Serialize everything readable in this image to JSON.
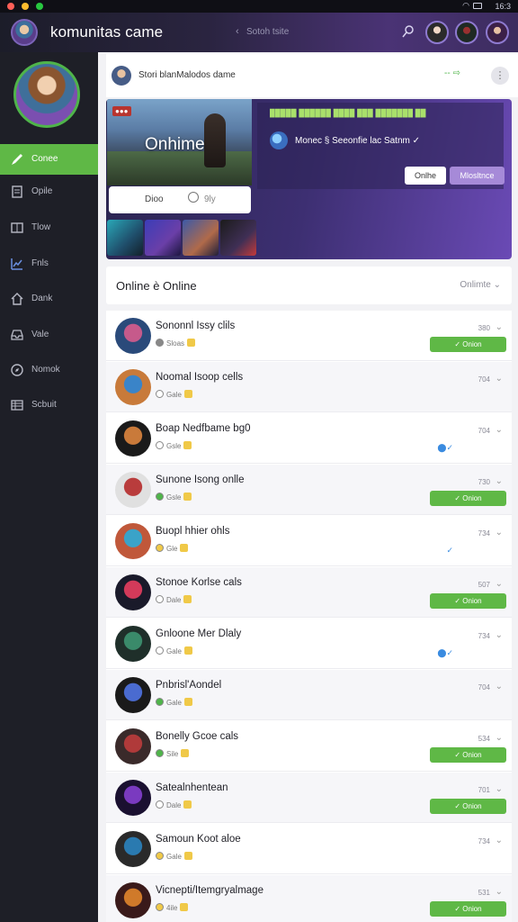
{
  "system": {
    "status": "16:3"
  },
  "header": {
    "title": "komunitas came",
    "search_text": "Sotoh tsite"
  },
  "breadcrumb": {
    "text": "Stori blanMalodos dame",
    "action": "-- ⇨"
  },
  "sidebar": {
    "items": [
      {
        "label": "Conee",
        "icon": "pen-icon"
      },
      {
        "label": "Opile",
        "icon": "document-icon"
      },
      {
        "label": "Tlow",
        "icon": "book-icon"
      },
      {
        "label": "Fnls",
        "icon": "chart-icon"
      },
      {
        "label": "Dank",
        "icon": "home-icon"
      },
      {
        "label": "Vale",
        "icon": "inbox-icon"
      },
      {
        "label": "Nomok",
        "icon": "compass-icon"
      },
      {
        "label": "Scbuit",
        "icon": "grid-icon"
      }
    ]
  },
  "banner": {
    "badge": "●●●",
    "feature_title": "Onhime",
    "feature_card": {
      "count": "Dioo",
      "tag": "9ly"
    },
    "promo_header": "█████ ██████ ████ ███ ███████ ██",
    "promo_text": "Monec § Seeonfie lac Satnm ✓",
    "btn_secondary": "Onlhe",
    "btn_primary": "Mlosltnce"
  },
  "section": {
    "title": "Online è Online",
    "filter": "Onlimte"
  },
  "list": [
    {
      "name": "Sononnl Issy clils",
      "sub": "Sloas",
      "num": "380",
      "btn": "✓ Onion",
      "status": "#888",
      "badge": ""
    },
    {
      "name": "Noomal Isoop cells",
      "sub": "Gale",
      "num": "704",
      "btn": "",
      "status": "#fff",
      "badge": ""
    },
    {
      "name": "Boap Nedfbame bg0",
      "sub": "Gsle",
      "num": "704",
      "btn": "",
      "status": "#fff",
      "badge": "⬤✓"
    },
    {
      "name": "Sunone Isong onlle",
      "sub": "Gsle",
      "num": "730",
      "btn": "✓ Onion",
      "status": "#4fb44a",
      "badge": ""
    },
    {
      "name": "Buopl hhier ohls",
      "sub": "Gle",
      "num": "734",
      "btn": "",
      "status": "#f0c948",
      "badge": "✓"
    },
    {
      "name": "Stonoe Korlse cals",
      "sub": "Dale",
      "num": "507",
      "btn": "✓ Onion",
      "status": "#fff",
      "badge": ""
    },
    {
      "name": "Gnloone Mer Dlaly",
      "sub": "Gale",
      "num": "734",
      "btn": "",
      "status": "#fff",
      "badge": "⬤✓"
    },
    {
      "name": "Pnbrisl'Aondel",
      "sub": "Gale",
      "num": "704",
      "btn": "",
      "status": "#4fb44a",
      "badge": ""
    },
    {
      "name": "Bonelly Gcoe cals",
      "sub": "Sile",
      "num": "534",
      "btn": "✓ Onion",
      "status": "#4fb44a",
      "badge": ""
    },
    {
      "name": "Satealnhentean",
      "sub": "Dale",
      "num": "701",
      "btn": "✓ Onion",
      "status": "#fff",
      "badge": ""
    },
    {
      "name": "Samoun Koot aloe",
      "sub": "Gale",
      "num": "734",
      "btn": "",
      "status": "#f0c948",
      "badge": ""
    },
    {
      "name": "Vicnepti/Itemgryalmage",
      "sub": "4ile",
      "num": "531",
      "btn": "✓ Onion",
      "status": "#f0c948",
      "badge": ""
    }
  ],
  "colors": {
    "accent": "#5fb846",
    "brand": "#6a4ab5",
    "verify": "#3a8be0"
  }
}
